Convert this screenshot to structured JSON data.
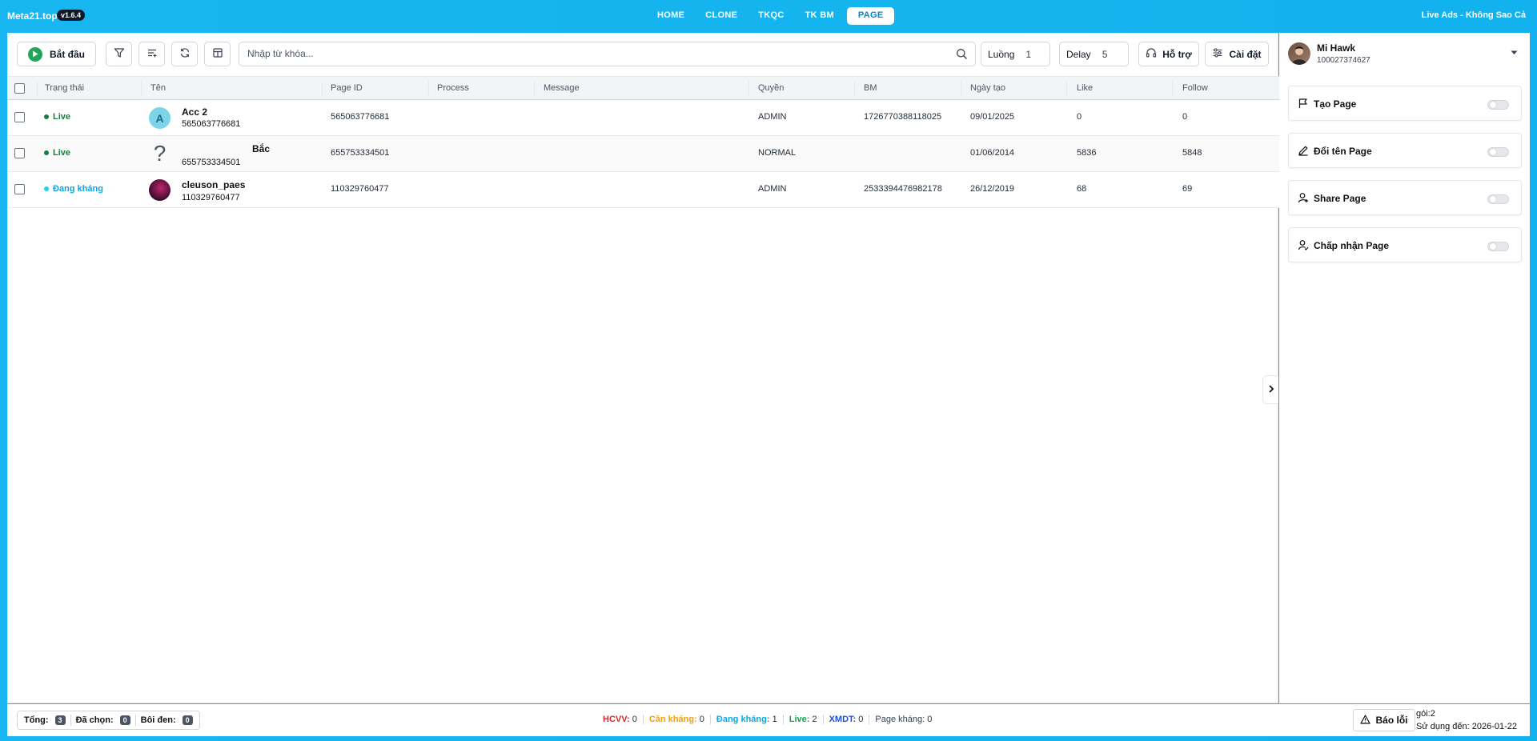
{
  "app": {
    "brand": "Meta21.top",
    "version": "v1.6.4",
    "live_ads": "Live Ads - Không Sao Cả"
  },
  "nav": {
    "tabs": [
      "HOME",
      "CLONE",
      "TKQC",
      "TK BM",
      "PAGE"
    ],
    "active": "PAGE"
  },
  "toolbar": {
    "start_label": "Bắt đầu",
    "search_placeholder": "Nhập từ khóa...",
    "threads_label": "Luồng",
    "threads_value": "1",
    "delay_label": "Delay",
    "delay_value": "5",
    "support_label": "Hỗ trợ",
    "settings_label": "Cài đặt"
  },
  "table": {
    "columns": [
      "Trạng thái",
      "Tên",
      "Page ID",
      "Process",
      "Message",
      "Quyền",
      "BM",
      "Ngày tạo",
      "Like",
      "Follow"
    ],
    "rows": [
      {
        "status": "Live",
        "name": "Acc 2",
        "sub": "565063776681",
        "avatar_letter": "A",
        "page_id": "565063776681",
        "process": "",
        "message": "",
        "role": "ADMIN",
        "bm": "1726770388118025",
        "created": "09/01/2025",
        "like": "0",
        "follow": "0"
      },
      {
        "status": "Live",
        "name": "Bắc",
        "sub": "655753334501",
        "avatar_letter": "?",
        "page_id": "655753334501",
        "process": "",
        "message": "",
        "role": "NORMAL",
        "bm": "",
        "created": "01/06/2014",
        "like": "5836",
        "follow": "5848"
      },
      {
        "status": "Đang kháng",
        "name": "cleuson_paes",
        "sub": "110329760477",
        "avatar_letter": "",
        "page_id": "110329760477",
        "process": "",
        "message": "",
        "role": "ADMIN",
        "bm": "2533394476982178",
        "created": "26/12/2019",
        "like": "68",
        "follow": "69"
      }
    ]
  },
  "profile": {
    "name": "Mi Hawk",
    "id": "100027374627"
  },
  "features": [
    {
      "label": "Tạo Page",
      "icon": "flag-icon"
    },
    {
      "label": "Đổi tên Page",
      "icon": "pencil-icon"
    },
    {
      "label": "Share Page",
      "icon": "user-plus-icon"
    },
    {
      "label": "Chấp nhận Page",
      "icon": "user-check-icon"
    }
  ],
  "footer": {
    "total_label": "Tổng:",
    "total": "3",
    "selected_label": "Đã chọn:",
    "selected": "0",
    "highlight_label": "Bôi đen:",
    "highlight": "0",
    "stats": [
      {
        "label": "HCVV:",
        "value": "0",
        "color": "#dc2626"
      },
      {
        "label": "Cần kháng:",
        "value": "0",
        "color": "#f59e0b"
      },
      {
        "label": "Đang kháng:",
        "value": "1",
        "color": "#0ea5e9"
      },
      {
        "label": "Live:",
        "value": "2",
        "color": "#16a34a"
      },
      {
        "label": "XMDT:",
        "value": "0",
        "color": "#1d4ed8"
      },
      {
        "label": "Page kháng:",
        "value": "0",
        "color": "#374151"
      }
    ],
    "report_label": "Báo lỗi",
    "plan": "gói:2",
    "expiry": "Sử dụng đến: 2026-01-22"
  },
  "colors": {
    "accent": "#12b2ee",
    "live": "#15803d",
    "appeal": "#0ea5e9",
    "start": "#22a55a"
  }
}
